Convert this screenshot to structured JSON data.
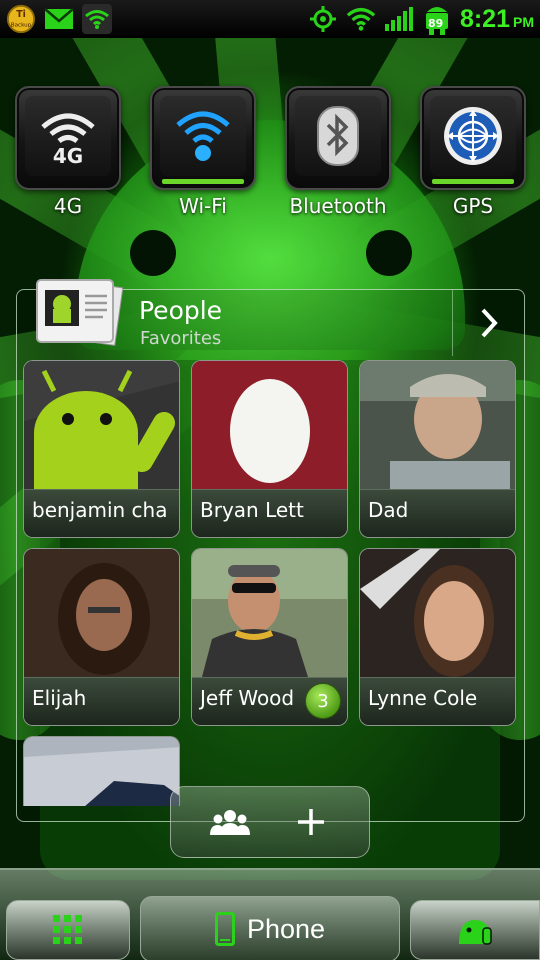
{
  "status_bar": {
    "time": "8:21",
    "ampm": "PM",
    "battery_level": "89",
    "backup_label": "Backup",
    "icons": [
      "backup-icon",
      "mail-icon",
      "wifi-status-icon",
      "gps-status-icon",
      "wifi-signal-icon",
      "cell-signal-icon",
      "battery-icon"
    ],
    "accent": "#3df025"
  },
  "toggles": [
    {
      "label": "4G",
      "icon": "4g-icon",
      "text": "4G"
    },
    {
      "label": "Wi-Fi",
      "icon": "wifi-icon"
    },
    {
      "label": "Bluetooth",
      "icon": "bluetooth-icon"
    },
    {
      "label": "GPS",
      "icon": "gps-icon"
    }
  ],
  "people": {
    "title": "People",
    "subtitle": "Favorites",
    "contacts": [
      {
        "name": "benjamin cha"
      },
      {
        "name": "Bryan Lett"
      },
      {
        "name": "Dad"
      },
      {
        "name": "Elijah"
      },
      {
        "name": "Jeff Wood",
        "badge": "3"
      },
      {
        "name": "Lynne Cole"
      },
      {
        "name": ""
      }
    ]
  },
  "actions": {
    "groups_icon": "groups-icon",
    "add_icon": "add-icon"
  },
  "dock": {
    "phone_label": "Phone",
    "left_icon": "apps-grid-icon",
    "right_icon": "android-settings-icon"
  }
}
